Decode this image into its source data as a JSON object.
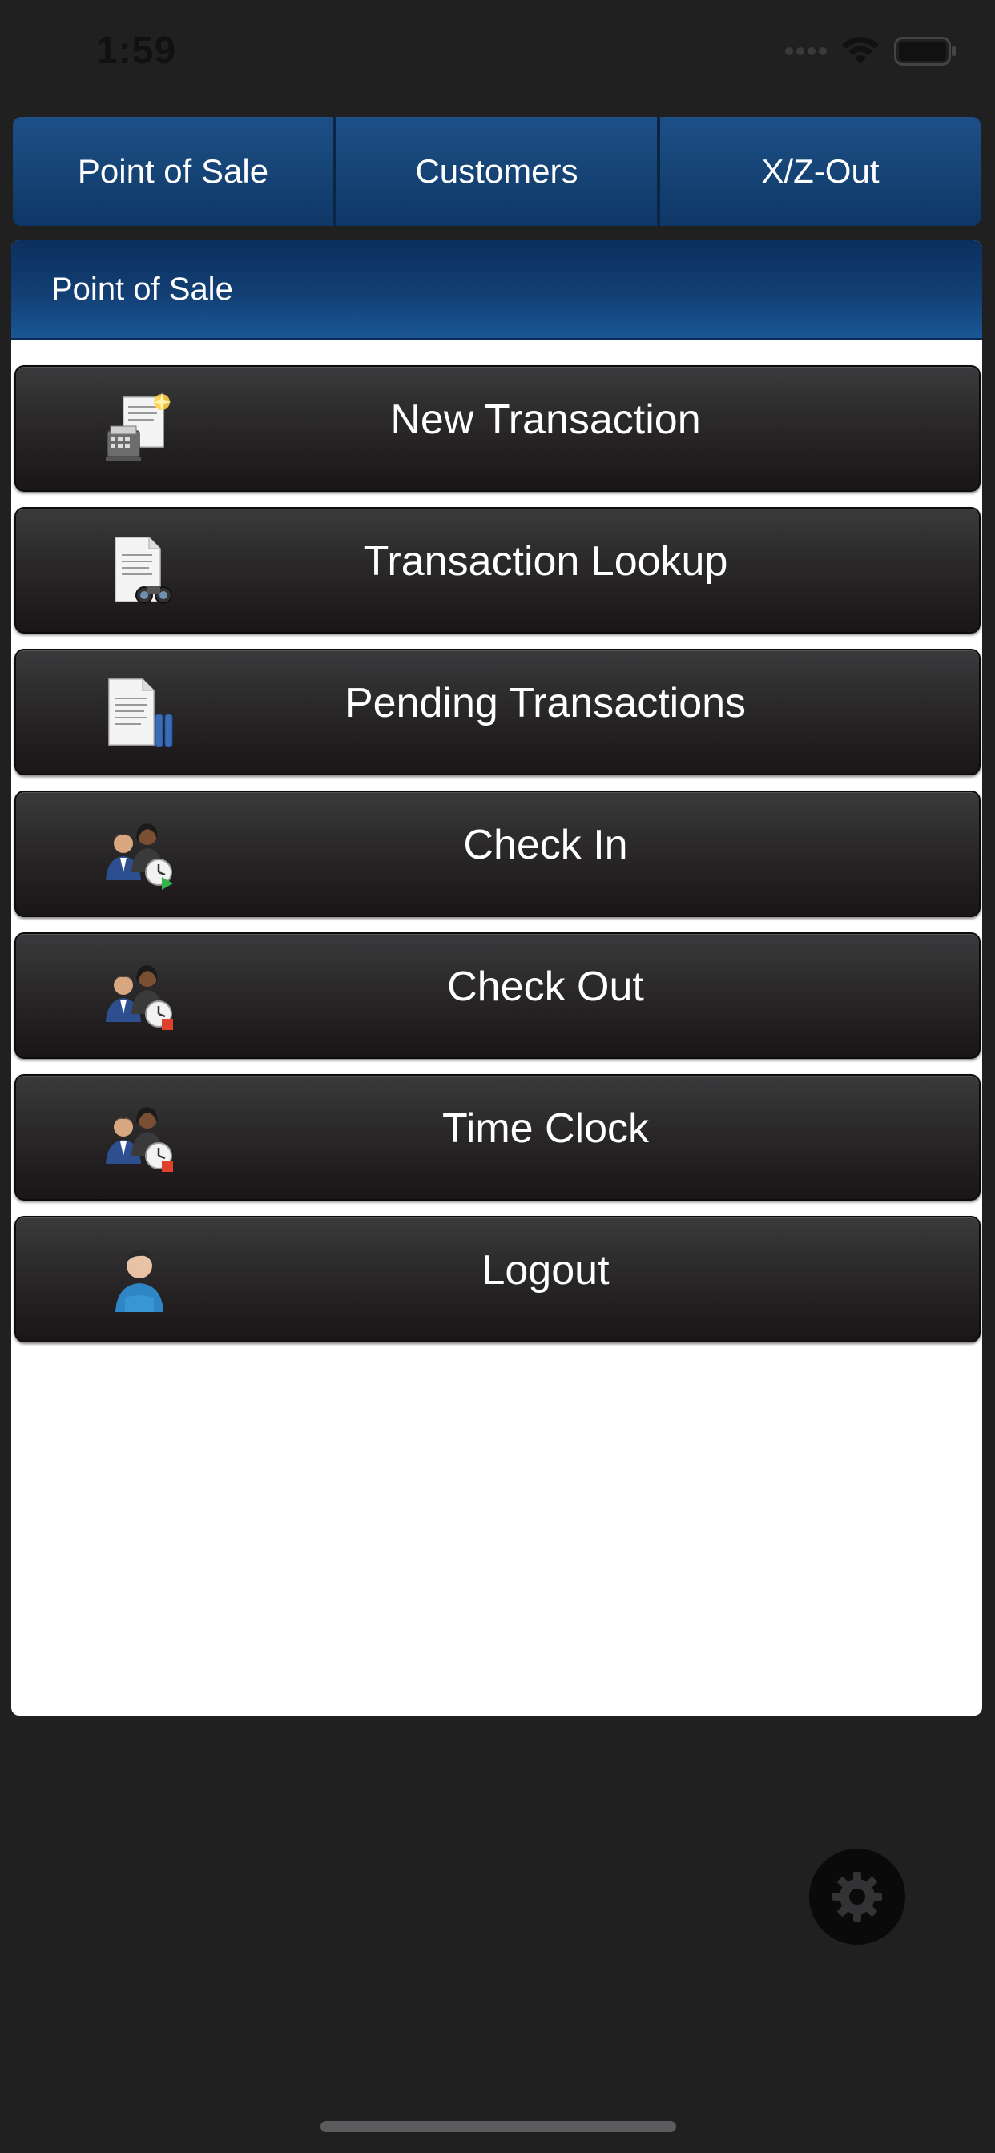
{
  "status_bar": {
    "time": "1:59"
  },
  "top_tabs": [
    {
      "label": "Point of Sale"
    },
    {
      "label": "Customers"
    },
    {
      "label": "X/Z-Out"
    }
  ],
  "panel": {
    "title": "Point of Sale"
  },
  "menu": [
    {
      "label": "New Transaction",
      "icon": "cash-register-document-icon"
    },
    {
      "label": "Transaction Lookup",
      "icon": "document-binoculars-icon"
    },
    {
      "label": "Pending Transactions",
      "icon": "document-pending-icon"
    },
    {
      "label": "Check In",
      "icon": "people-clock-in-icon"
    },
    {
      "label": "Check Out",
      "icon": "people-clock-out-icon"
    },
    {
      "label": "Time Clock",
      "icon": "people-clock-icon"
    },
    {
      "label": "Logout",
      "icon": "user-logout-icon"
    }
  ],
  "colors": {
    "background": "#202021",
    "tab_blue": "#164476",
    "header_blue": "#123f74",
    "button_dark": "#2a2829",
    "panel_white": "#ffffff"
  },
  "settings": {
    "icon": "gear-icon"
  }
}
